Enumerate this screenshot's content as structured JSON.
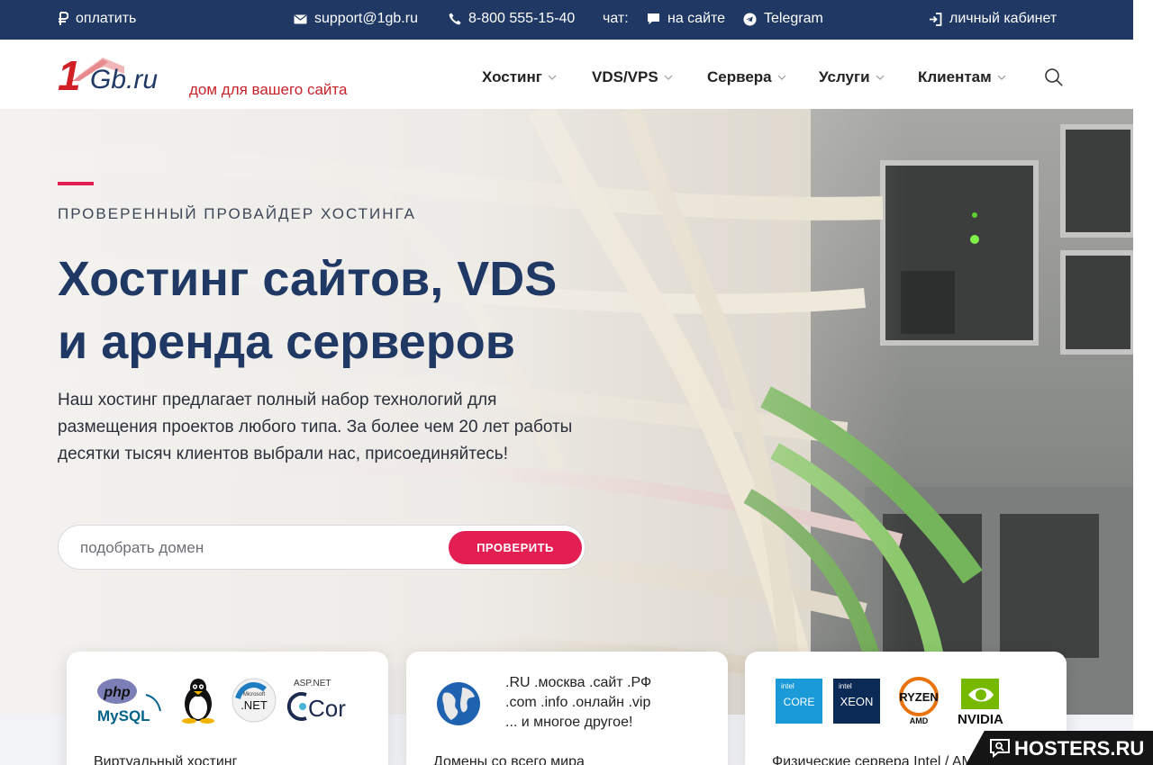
{
  "topbar": {
    "pay": "оплатить",
    "email": "support@1gb.ru",
    "phone": "8-800 555-15-40",
    "chat_label": "чат:",
    "chat_site": "на сайте",
    "chat_telegram": "Telegram",
    "account": "личный кабинет"
  },
  "header": {
    "logo_one": "1",
    "logo_gb": "Gb.ru",
    "slogan": "дом для вашего сайта",
    "nav": [
      "Хостинг",
      "VDS/VPS",
      "Сервера",
      "Услуги",
      "Клиентам"
    ]
  },
  "hero": {
    "eyebrow": "ПРОВЕРЕННЫЙ ПРОВАЙДЕР ХОСТИНГА",
    "title_line1": "Хостинг сайтов, VDS",
    "title_line2": "и аренда серверов",
    "lead": "Наш хостинг предлагает полный набор технологий для размещения проектов любого типа. За более чем 20 лет работы десятки тысяч клиентов выбрали нас, присоединяйтесь!",
    "domain_placeholder": "подобрать домен",
    "check_button": "ПРОВЕРИТЬ"
  },
  "cards": [
    {
      "logos": [
        "php",
        "MySQL",
        "Microsoft",
        ".NET",
        "ASP.NET",
        "Core"
      ],
      "caption": "Виртуальный хостинг"
    },
    {
      "zones_line1": ".RU  .москва  .сайт  .РФ",
      "zones_line2": ".com  .info  .онлайн  .vip",
      "zones_line3": "... и многое другое!",
      "caption": "Домены со всего мира"
    },
    {
      "logos": [
        "intel",
        "CORE",
        "intel",
        "XEON",
        "RYZEN",
        "AMD",
        "NVIDIA"
      ],
      "caption": "Физические сервера Intel / AMD"
    }
  ],
  "watermark": "HOSTERS.RU",
  "colors": {
    "navy": "#1f3864",
    "accent_pink": "#e31e52",
    "logo_red": "#d11f26"
  }
}
